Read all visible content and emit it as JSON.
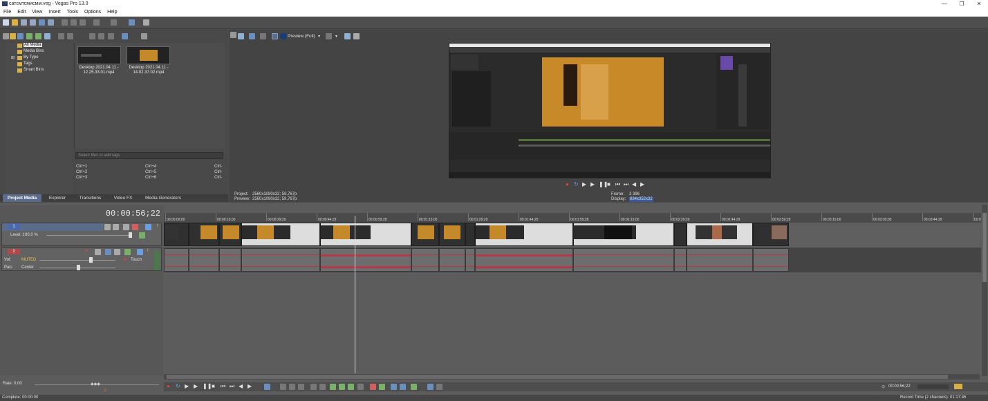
{
  "window": {
    "title": "cатсмтсмисмм.veg - Vegas Pro 13.0",
    "controls": [
      "—",
      "❐",
      "✕"
    ]
  },
  "menu": [
    "File",
    "Edit",
    "View",
    "Insert",
    "Tools",
    "Options",
    "Help"
  ],
  "project_media": {
    "tree": [
      "All Media",
      "Media Bins",
      "By Type",
      "Tags",
      "Smart Bins"
    ],
    "files": [
      {
        "label": "Desktop 2021.04.11 - 12.25.33.01.mp4"
      },
      {
        "label": "Desktop 2021.04.11 - 14.02.37.02.mp4"
      }
    ],
    "tags_placeholder": "Select files to add tags",
    "shortcuts": [
      [
        "Ctrl+1",
        "Ctrl+4",
        "Ctrl-"
      ],
      [
        "Ctrl+2",
        "Ctrl+5",
        "Ctrl-"
      ],
      [
        "Ctrl+3",
        "Ctrl+6",
        "Ctrl-"
      ]
    ]
  },
  "tabs": [
    "Project Media",
    "Explorer",
    "Transitions",
    "Video FX",
    "Media Generators"
  ],
  "preview": {
    "mode": "Preview (Full)",
    "project_label": "Project:",
    "project_value": "2560x1080x32; 59,767p",
    "preview_label": "Preview:",
    "preview_value": "2560x1080x32; 59,767p",
    "frame_label": "Frame:",
    "frame_value": "3 396",
    "display_label": "Display:",
    "display_value": "834x352x32"
  },
  "timeline": {
    "timecode": "00:00:56;22",
    "ruler": [
      "00:00:00;00",
      "00:00:15;00",
      "00:00:29;29",
      "00:00:44;29",
      "00:00:59;28",
      "00:01:15;00",
      "00:01:29;29",
      "00:01:44;29",
      "00:01:59;28",
      "00:02:15;00",
      "00:02:29;29",
      "00:02:44;29",
      "00:02:59;29",
      "00:03:15;00",
      "00:03:30;00",
      "00:03:44;29",
      "00:0"
    ],
    "video_track": {
      "number": "1",
      "level": "Level: 100,0 %"
    },
    "audio_track": {
      "number": "2",
      "vol_label": "Vol:",
      "vol_value": "MUTED",
      "pan_label": "Pan:",
      "pan_value": "Center",
      "touch": "Touch"
    },
    "rate": "Rate: 0,00",
    "end_time": "00:00:56;22"
  },
  "status": {
    "left": "Complete: 00:00:00",
    "right": "Record Time (2 channels): 01:17:45"
  },
  "colors": {
    "accent": "#5b6b8a",
    "clip_video": "#c48a2a",
    "waveform": "#b23a4a",
    "muted": "#e6c84a"
  }
}
